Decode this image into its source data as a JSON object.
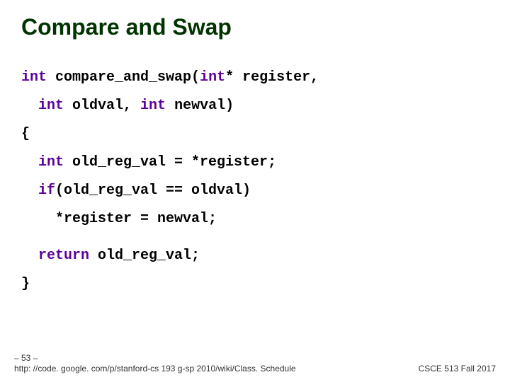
{
  "title": "Compare and Swap",
  "code": {
    "l1_a": "int",
    "l1_b": " compare_and_swap(",
    "l1_c": "int",
    "l1_d": "* register,",
    "l2_a": "  int",
    "l2_b": " oldval, ",
    "l2_c": "int",
    "l2_d": " newval)",
    "l3": "{",
    "l4_a": "  int",
    "l4_b": " old_reg_val = *register;",
    "l5_a": "  if",
    "l5_b": "(old_reg_val == oldval)",
    "l6": "    *register = newval;",
    "l7_a": "  return",
    "l7_b": " old_reg_val;",
    "l8": "}"
  },
  "footer": {
    "page": "– 53 –",
    "url": "http: //code. google. com/p/stanford-cs 193 g-sp 2010/wiki/Class. Schedule",
    "course": "CSCE 513 Fall 2017"
  }
}
